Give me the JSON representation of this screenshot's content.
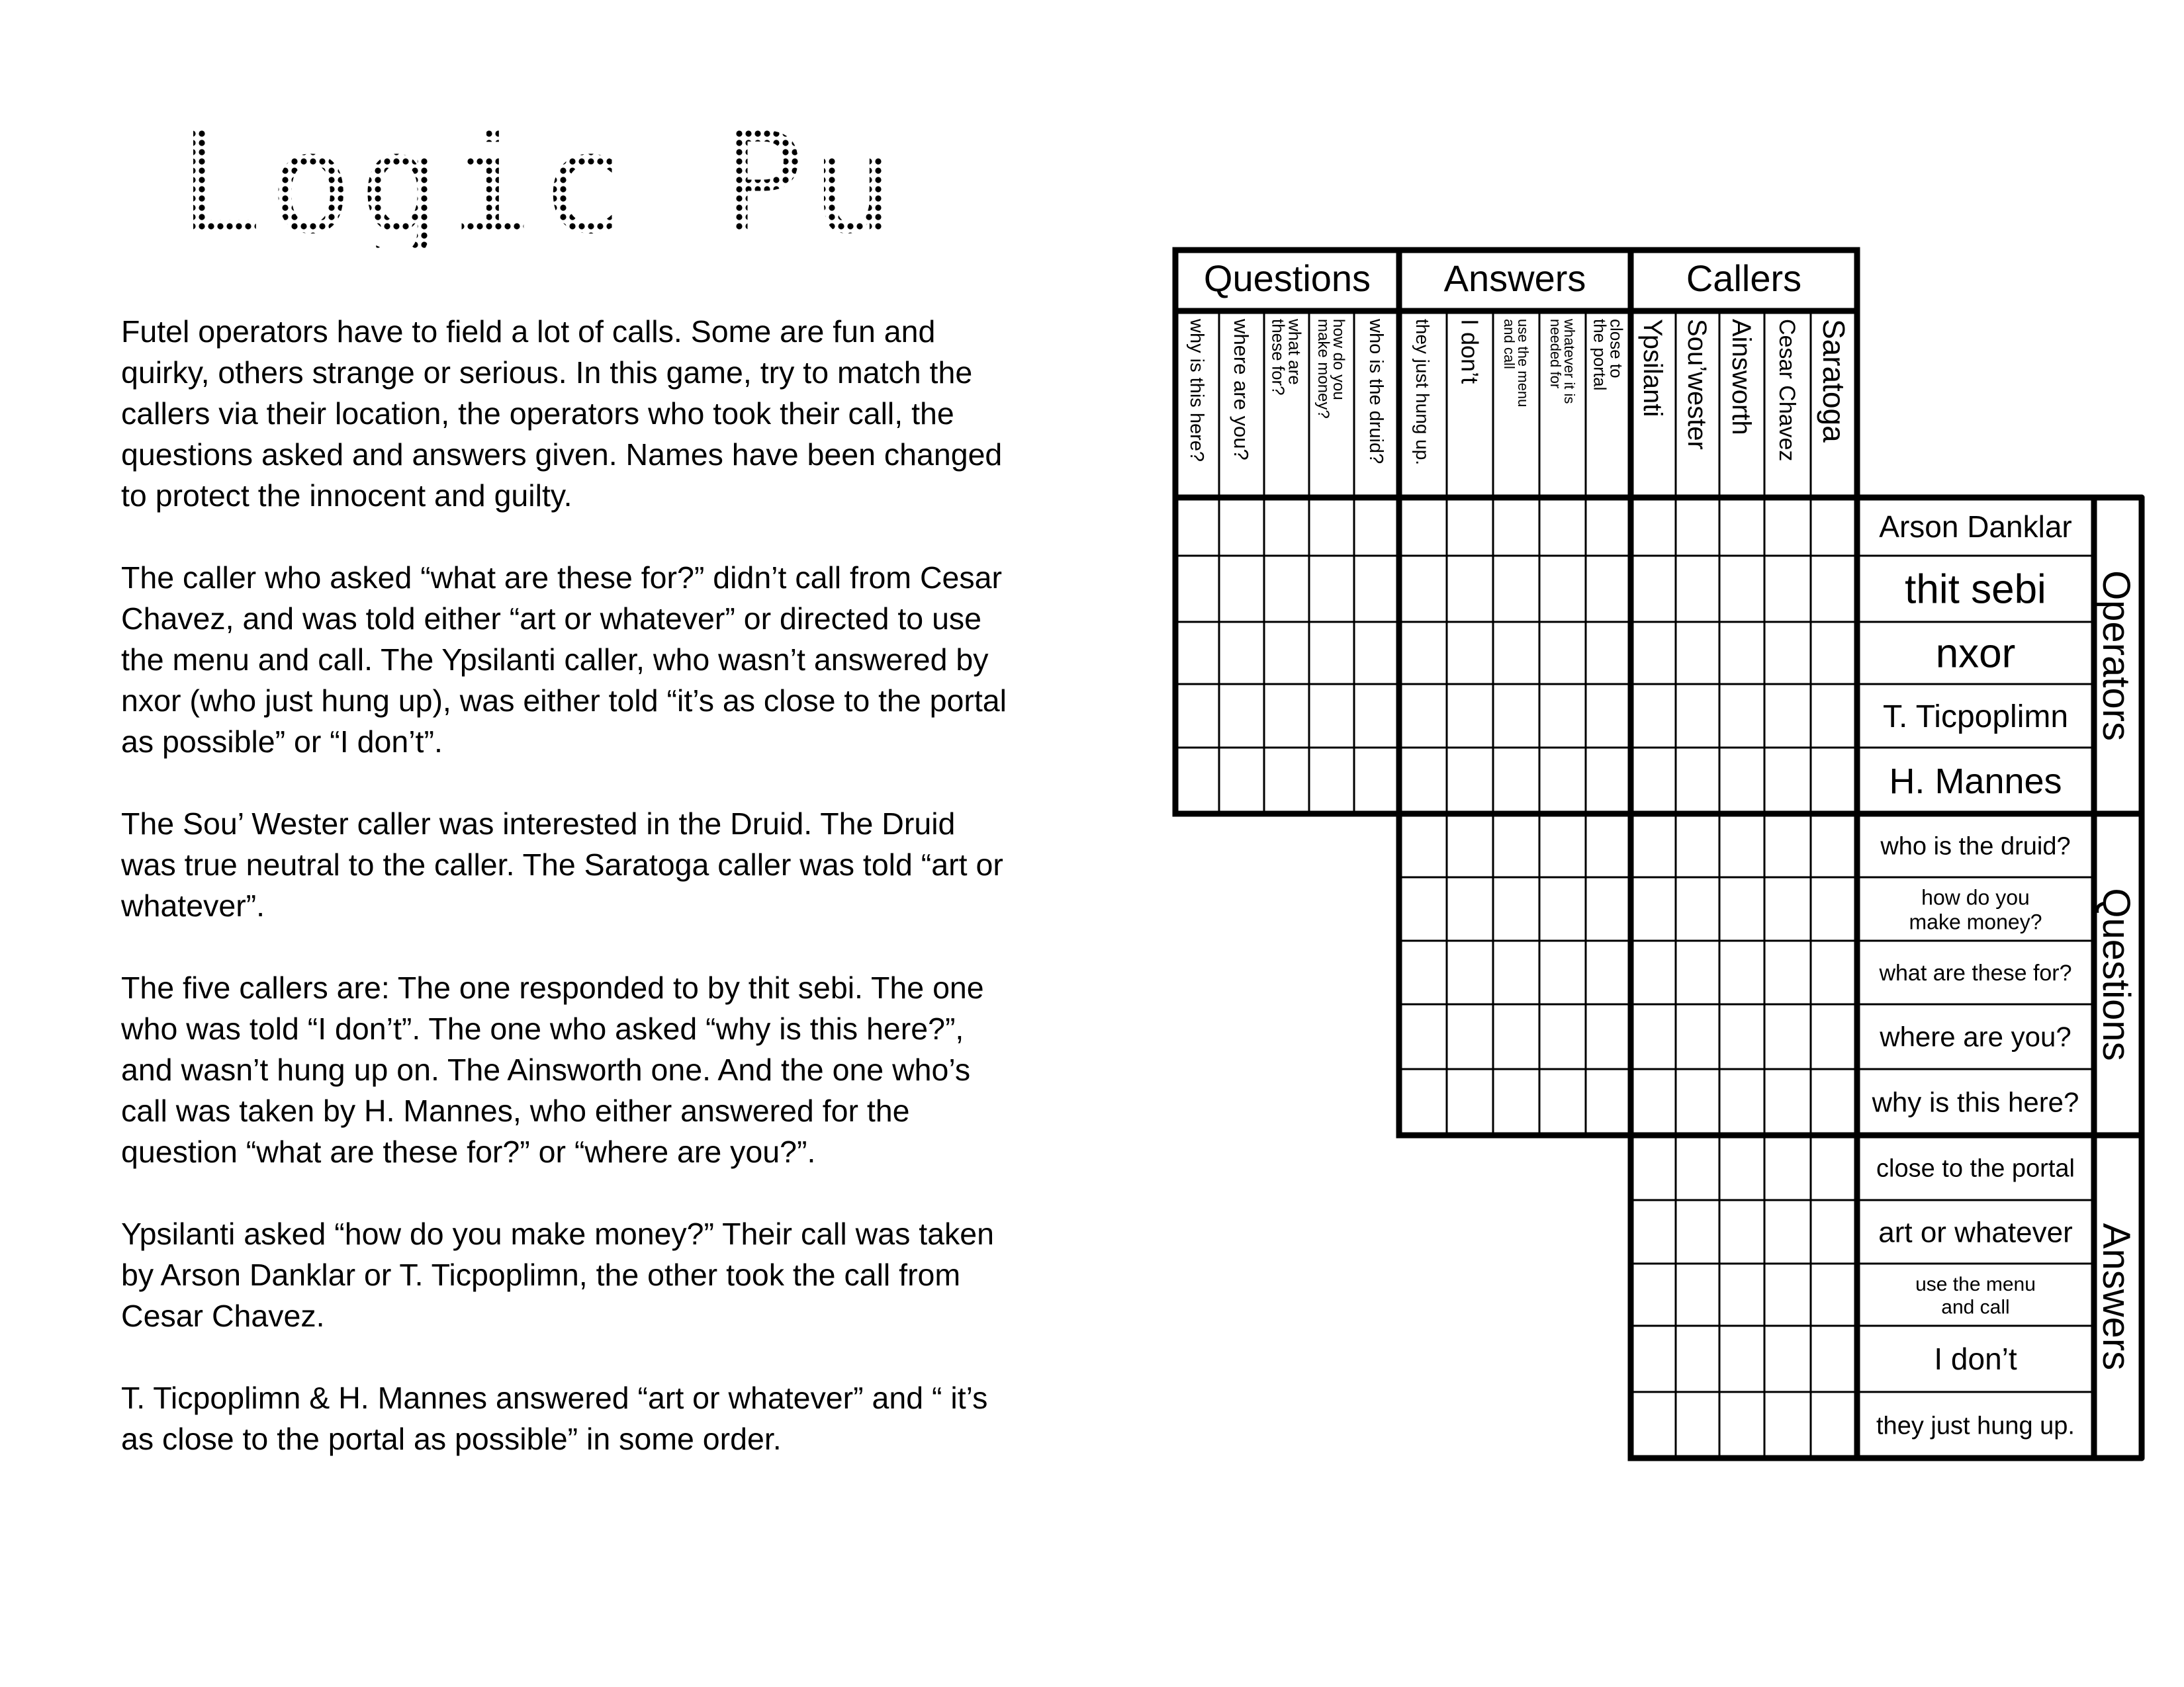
{
  "title": "Logic Puzzle",
  "intro": [
    "Futel operators have to field a lot of calls. Some are fun and quirky, others strange or serious. In this game, try to match the callers via their location, the operators who took their call, the questions asked and answers given. Names have been changed to protect the innocent and guilty.",
    "The caller who asked “what are these for?” didn’t call from Cesar Chavez, and was told either “art or whatever” or directed to use the menu and call. The Ypsilanti caller, who wasn’t answered by nxor (who just hung up), was either told “it’s as close to the portal as possible” or “I don’t”.",
    "The Sou’ Wester caller was interested in the Druid. The Druid was true neutral to the caller. The Saratoga caller was told “art or whatever”.",
    "The five callers are: The one responded to by thit sebi. The one who was told “I don’t”. The one who asked “why is this here?”, and wasn’t hung up on. The Ainsworth one. And the one who’s call was taken by H. Mannes, who either answered for the question “what are these for?” or “where are you?”.",
    "Ypsilanti asked “how do you make money?” Their call was taken by Arson Danklar or T. Ticpoplimn, the other  took the call from Cesar Chavez.",
    "T. Ticpoplimn  & H. Mannes answered “art or whatever” and “ it’s as close to the portal as possible” in some order."
  ],
  "grid": {
    "column_groups": {
      "questions": "Questions",
      "answers": "Answers",
      "callers": "Callers"
    },
    "row_groups": {
      "operators": "Operators",
      "questions": "Questions",
      "answers": "Answers"
    },
    "column_labels": {
      "questions": [
        "why is this here?",
        "where are you?",
        "what are these for?",
        "how do you make money?",
        "who is the druid?"
      ],
      "answers": [
        "they just hung up.",
        "I don’t",
        "use the menu and call",
        "whatever it is needed for",
        "close to the portal"
      ],
      "callers": [
        "Ypsilanti",
        "Sou’wester",
        "Ainsworth",
        "Cesar Chavez",
        "Saratoga"
      ]
    },
    "row_labels": {
      "operators": [
        "Arson Danklar",
        "thit sebi",
        "nxor",
        "T. Ticpoplimn",
        "H. Mannes"
      ],
      "questions": [
        "who is the druid?",
        "how do you make money?",
        "what are these for?",
        "where are you?",
        "why is this here?"
      ],
      "answers": [
        "close to the portal",
        "art or whatever",
        "use the menu and call",
        "I don’t",
        "they just hung up."
      ]
    }
  }
}
